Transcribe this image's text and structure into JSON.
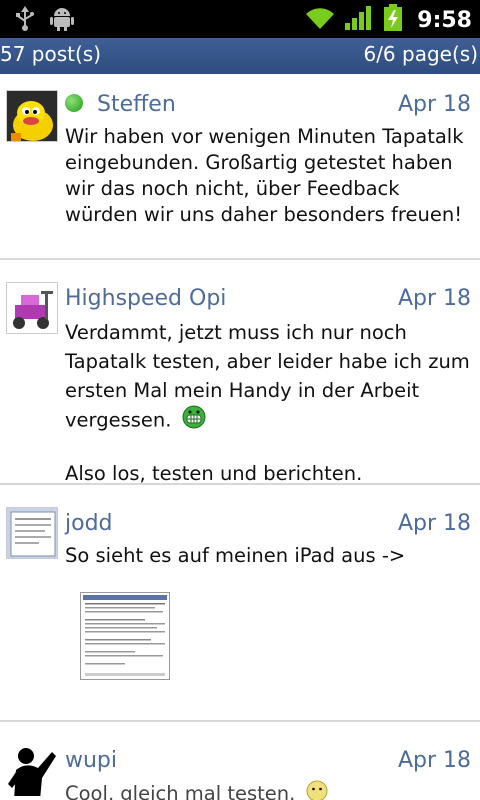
{
  "statusbar": {
    "time": "9:58",
    "icons": [
      "usb-icon",
      "android-debug-icon",
      "wifi-icon",
      "signal-icon",
      "battery-charging-icon"
    ]
  },
  "pagebar": {
    "posts": "57 post(s)",
    "pages": "6/6 page(s)"
  },
  "posts": [
    {
      "author": "Steffen",
      "online": true,
      "date": "Apr 18",
      "text": "Wir haben vor wenigen Minuten Tapatalk eingebunden. Großartig getestet haben wir das noch nicht, über Feedback würden wir uns daher besonders freuen!",
      "avatar": "yellow-character-avatar"
    },
    {
      "author": "Highspeed Opi",
      "online": false,
      "date": "Apr 18",
      "text1": "Verdammt, jetzt muss ich nur noch Tapatalk testen, aber leider habe ich zum ersten Mal mein Handy in der Arbeit vergessen.",
      "text2": "Also los, testen und berichten.",
      "avatar": "scooter-avatar"
    },
    {
      "author": "jodd",
      "online": false,
      "date": "Apr 18",
      "text": "So sieht es auf meinen iPad aus ->",
      "avatar": "document-avatar"
    },
    {
      "author": "wupi",
      "online": false,
      "date": "Apr 18",
      "text": "Cool, gleich mal testen.",
      "avatar": "silhouette-avatar"
    }
  ],
  "colors": {
    "header_blue": "#2e4c7f",
    "author_blue": "#4d6b9b",
    "online_green": "#1b9e16"
  }
}
